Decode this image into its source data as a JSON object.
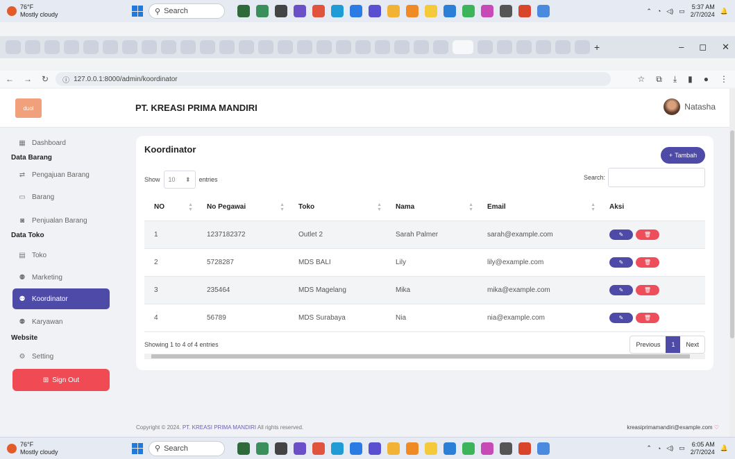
{
  "taskbar_top": {
    "temp": "76°F",
    "weather": "Mostly cloudy",
    "search": "Search",
    "time": "5:37 AM",
    "date": "2/7/2024"
  },
  "taskbar_bottom": {
    "temp": "76°F",
    "weather": "Mostly cloudy",
    "search": "Search",
    "time": "6:05 AM",
    "date": "2/7/2024"
  },
  "browser": {
    "url": "127.0.0.1:8000/admin/koordinator"
  },
  "header": {
    "logo": "duol",
    "company": "PT. KREASI PRIMA MANDIRI",
    "user": "Natasha"
  },
  "sidebar": {
    "dashboard": "Dashboard",
    "section_barang": "Data Barang",
    "pengajuan": "Pengajuan Barang",
    "barang": "Barang",
    "penjualan": "Penjualan Barang",
    "section_toko": "Data Toko",
    "toko": "Toko",
    "marketing": "Marketing",
    "koordinator": "Koordinator",
    "karyawan": "Karyawan",
    "section_website": "Website",
    "setting": "Setting",
    "signout": "Sign Out"
  },
  "card": {
    "title": "Koordinator",
    "add_label": "Tambah",
    "show_label": "Show",
    "entries_value": "10",
    "entries_label": "entries",
    "search_label": "Search:",
    "columns": [
      "NO",
      "No Pegawai",
      "Toko",
      "Nama",
      "Email",
      "Aksi"
    ],
    "rows": [
      {
        "no": "1",
        "pegawai": "1237182372",
        "toko": "Outlet 2",
        "nama": "Sarah Palmer",
        "email": "sarah@example.com"
      },
      {
        "no": "2",
        "pegawai": "5728287",
        "toko": "MDS BALI",
        "nama": "Lily",
        "email": "lily@example.com"
      },
      {
        "no": "3",
        "pegawai": "235464",
        "toko": "MDS Magelang",
        "nama": "Mika",
        "email": "mika@example.com"
      },
      {
        "no": "4",
        "pegawai": "56789",
        "toko": "MDS Surabaya",
        "nama": "Nia",
        "email": "nia@example.com"
      }
    ],
    "info": "Showing 1 to 4 of 4 entries",
    "prev": "Previous",
    "page": "1",
    "next": "Next"
  },
  "footer": {
    "copyright": "Copyright © 2024.",
    "brand": "PT. KREASI PRIMA MANDIRI",
    "rights": "All rights reserved.",
    "email": "kreasiprimamandiri@example.com"
  },
  "colors": {
    "accent": "#4e4aa8",
    "danger": "#ee4d5a"
  }
}
